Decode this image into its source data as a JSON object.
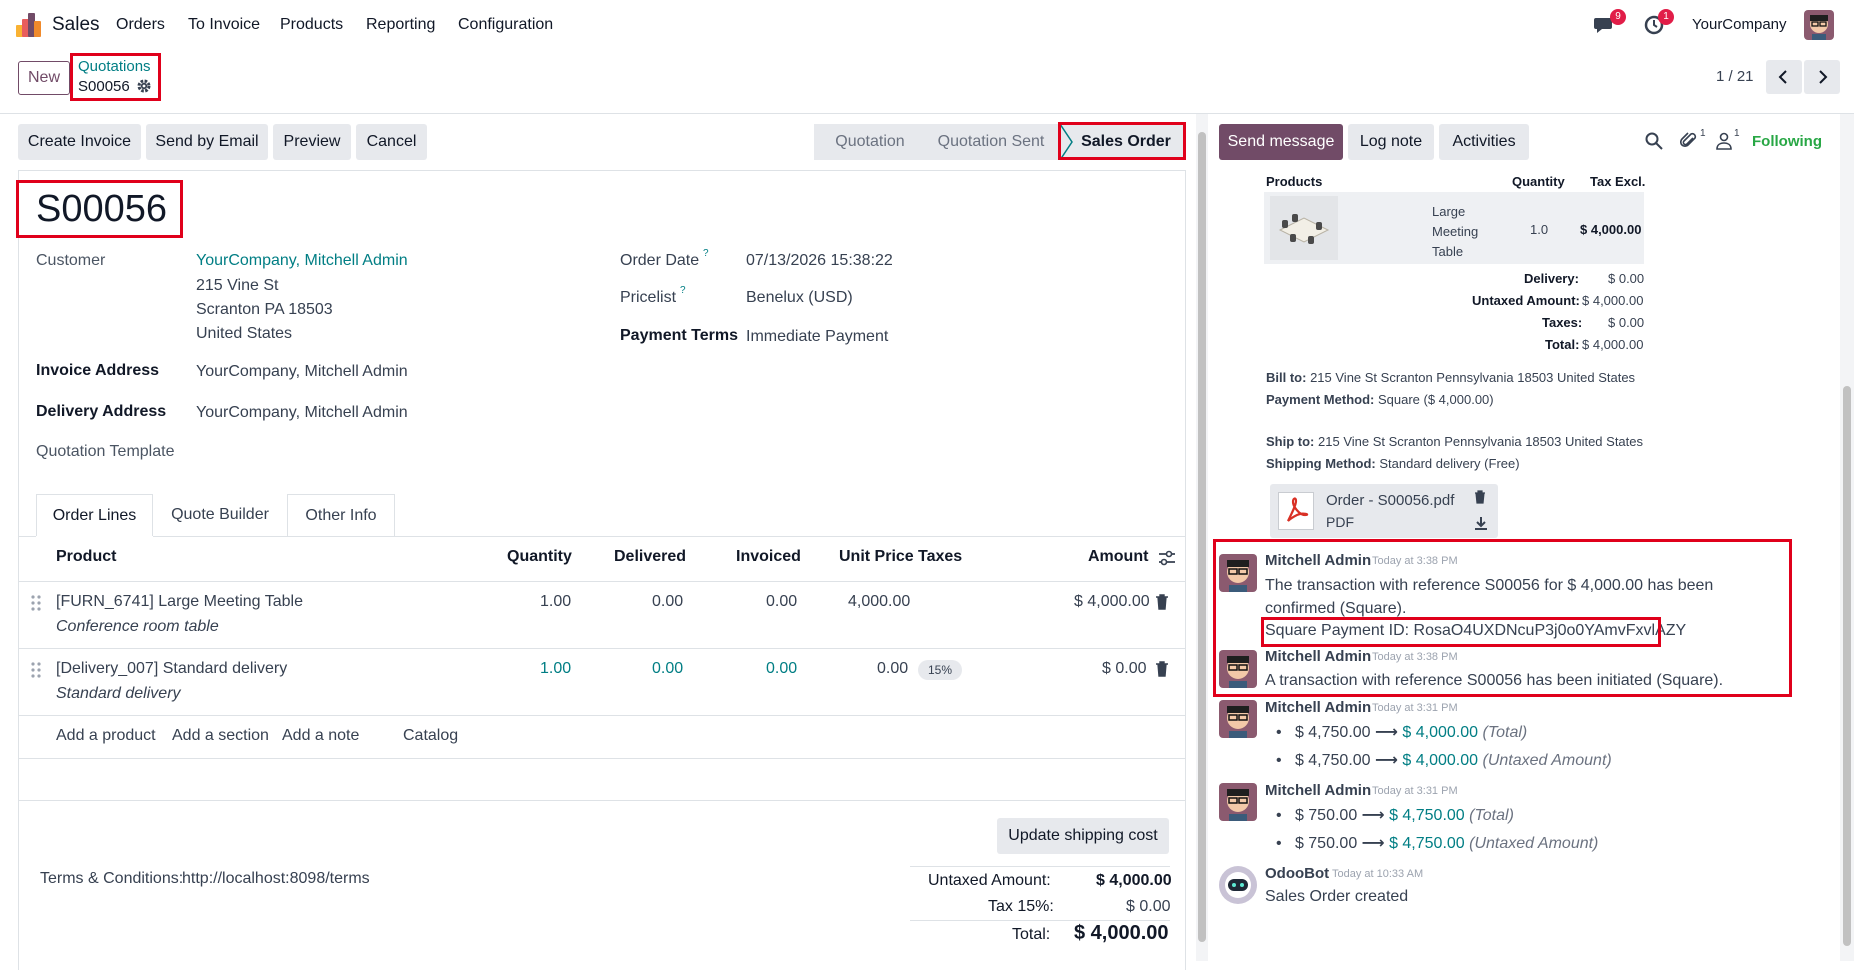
{
  "topbar": {
    "app": "Sales",
    "menu": [
      "Orders",
      "To Invoice",
      "Products",
      "Reporting",
      "Configuration"
    ],
    "messages_count": "9",
    "activities_count": "1",
    "company": "YourCompany"
  },
  "control": {
    "new_label": "New",
    "breadcrumb_parent": "Quotations",
    "breadcrumb_current": "S00056",
    "pager": "1 / 21"
  },
  "actions": {
    "create_invoice": "Create Invoice",
    "send_email": "Send by Email",
    "preview": "Preview",
    "cancel": "Cancel"
  },
  "status": {
    "steps": [
      "Quotation",
      "Quotation Sent",
      "Sales Order"
    ],
    "active": "Sales Order"
  },
  "chatter_buttons": {
    "send_message": "Send message",
    "log_note": "Log note",
    "activities": "Activities",
    "attachments_count": "1",
    "followers_count": "1",
    "following": "Following"
  },
  "order": {
    "name": "S00056",
    "customer_label": "Customer",
    "customer_name": "YourCompany, Mitchell Admin",
    "address": [
      "215 Vine St",
      "Scranton PA 18503",
      "United States"
    ],
    "invoice_address_label": "Invoice Address",
    "invoice_address": "YourCompany, Mitchell Admin",
    "delivery_address_label": "Delivery Address",
    "delivery_address": "YourCompany, Mitchell Admin",
    "template_label": "Quotation Template",
    "order_date_label": "Order Date",
    "order_date": "07/13/2026 15:38:22",
    "pricelist_label": "Pricelist",
    "pricelist": "Benelux (USD)",
    "payment_terms_label": "Payment Terms",
    "payment_terms": "Immediate Payment",
    "help_mark": "?"
  },
  "tabs": [
    "Order Lines",
    "Quote Builder",
    "Other Info"
  ],
  "table": {
    "headers": {
      "product": "Product",
      "quantity": "Quantity",
      "delivered": "Delivered",
      "invoiced": "Invoiced",
      "unit_price": "Unit Price",
      "taxes": "Taxes",
      "amount": "Amount"
    },
    "rows": [
      {
        "product": "[FURN_6741] Large Meeting Table",
        "description": "Conference room table",
        "quantity": "1.00",
        "delivered": "0.00",
        "invoiced": "0.00",
        "unit_price": "4,000.00",
        "taxes": "",
        "amount": "$ 4,000.00"
      },
      {
        "product": "[Delivery_007] Standard delivery",
        "description": "Standard delivery",
        "quantity": "1.00",
        "delivered": "0.00",
        "invoiced": "0.00",
        "unit_price": "0.00",
        "taxes": "15%",
        "amount": "$ 0.00"
      }
    ],
    "add_links": {
      "product": "Add a product",
      "section": "Add a section",
      "note": "Add a note",
      "catalog": "Catalog"
    }
  },
  "footer": {
    "update_shipping": "Update shipping cost",
    "terms_label": "Terms & Conditions:",
    "terms_url": "http://localhost:8098/terms",
    "untaxed_label": "Untaxed Amount:",
    "untaxed": "$ 4,000.00",
    "tax_label": "Tax 15%:",
    "tax": "$ 0.00",
    "total_label": "Total:",
    "total": "$ 4,000.00"
  },
  "email_preview": {
    "headers": [
      "Products",
      "Quantity",
      "Tax Excl."
    ],
    "item_name": "Large Meeting Table",
    "item_qty": "1.0",
    "item_amount": "$ 4,000.00",
    "delivery_label": "Delivery:",
    "delivery": "$ 0.00",
    "untaxed_label": "Untaxed Amount:",
    "untaxed": "$ 4,000.00",
    "taxes_label": "Taxes:",
    "taxes": "$ 0.00",
    "total_label": "Total:",
    "total": "$ 4,000.00",
    "bill_to_label": "Bill to:",
    "bill_to": "215 Vine St Scranton Pennsylvania 18503 United States",
    "payment_method_label": "Payment Method:",
    "payment_method": "Square ($ 4,000.00)",
    "ship_to_label": "Ship to:",
    "ship_to": "215 Vine St Scranton Pennsylvania 18503 United States",
    "shipping_method_label": "Shipping Method:",
    "shipping_method": "Standard delivery (Free)",
    "attachment_name": "Order - S00056.pdf",
    "attachment_type": "PDF"
  },
  "messages": [
    {
      "author": "Mitchell Admin",
      "time": "Today at 3:38 PM",
      "text": "The transaction with reference S00056 for $ 4,000.00 has been confirmed (Square).",
      "extra": "Square Payment ID: RosaO4UXDNcuP3j0o0YAmvFxvlAZY"
    },
    {
      "author": "Mitchell Admin",
      "time": "Today at 3:38 PM",
      "text": "A transaction with reference S00056 has been initiated (Square)."
    },
    {
      "author": "Mitchell Admin",
      "time": "Today at 3:31 PM",
      "changes": [
        {
          "old": "$ 4,750.00",
          "new": "$ 4,000.00",
          "field": "(Total)"
        },
        {
          "old": "$ 4,750.00",
          "new": "$ 4,000.00",
          "field": "(Untaxed Amount)"
        }
      ]
    },
    {
      "author": "Mitchell Admin",
      "time": "Today at 3:31 PM",
      "changes": [
        {
          "old": "$ 750.00",
          "new": "$ 4,750.00",
          "field": "(Total)"
        },
        {
          "old": "$ 750.00",
          "new": "$ 4,750.00",
          "field": "(Untaxed Amount)"
        }
      ]
    },
    {
      "author": "OdooBot",
      "time": "Today at 10:33 AM",
      "text": "Sales Order created"
    }
  ],
  "colors": {
    "brand": "#714b67",
    "teal": "#017e84",
    "highlight": "#e0001b"
  }
}
